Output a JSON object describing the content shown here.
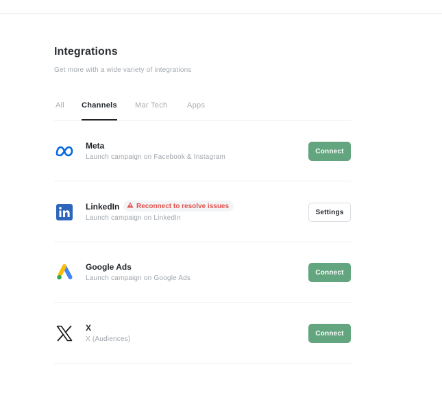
{
  "page": {
    "title": "Integrations",
    "subtitle": "Get more with a wide variety of integrations"
  },
  "tabs": [
    {
      "label": "All",
      "active": false
    },
    {
      "label": "Channels",
      "active": true
    },
    {
      "label": "Mar Tech",
      "active": false
    },
    {
      "label": "Apps",
      "active": false
    }
  ],
  "integrations": [
    {
      "name": "Meta",
      "description": "Launch campaign on Facebook & Instagram",
      "action": "Connect",
      "icon": "meta-icon"
    },
    {
      "name": "LinkedIn",
      "description": "Launch campaign on LinkedIn",
      "action": "Settings",
      "warning": "Reconnect to resolve issues",
      "icon": "linkedin-icon"
    },
    {
      "name": "Google Ads",
      "description": "Launch campaign on Google Ads",
      "action": "Connect",
      "icon": "google-ads-icon"
    },
    {
      "name": "X",
      "description": "X (Audiences)",
      "action": "Connect",
      "icon": "x-icon"
    }
  ],
  "colors": {
    "connect_button": "#62a57f",
    "warning_text": "#e0524f",
    "meta_blue": "#0668e1",
    "linkedin_blue": "#2d64bc"
  }
}
